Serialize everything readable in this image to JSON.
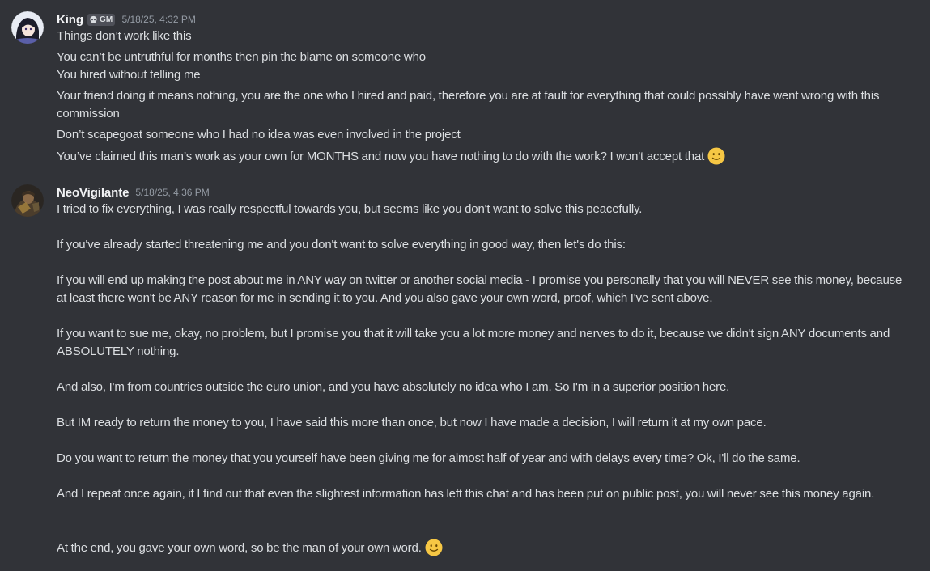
{
  "messages": [
    {
      "username": "King",
      "tag": "GM",
      "tag_icon": "skull-icon",
      "timestamp": "5/18/25, 4:32 PM",
      "lines": [
        "Things don’t work like this",
        "You can’t be untruthful for months then pin the blame on someone who",
        "You hired without telling me",
        "Your friend doing it means nothing, you are the one who I hired and paid, therefore you are at fault for everything that could possibly have went wrong with this commission",
        "Don’t scapegoat someone who I had no idea was even involved in the project",
        "You’ve claimed this man’s work as your own for MONTHS and now you have nothing to do with the work?  I won't accept that"
      ],
      "end_emoji": "slightly-smiling-face-emoji"
    },
    {
      "username": "NeoVigilante",
      "timestamp": "5/18/25, 4:36 PM",
      "lines": [
        "I tried to fix everything, I was really respectful towards you, but seems like you don't want to solve this peacefully.",
        "If you've already started threatening me and you don't want to solve everything in good way, then let's do this:",
        "If you will end up making the post about me in ANY way on twitter or another social media -  I promise you personally that you will NEVER see this money, because at least there won't be ANY reason for me in sending it to you. And you also gave your own word, proof, which I've sent above.",
        "If you want to sue me, okay, no problem, but I promise you that it will take you a lot more money and nerves to do it, because we didn't sign ANY documents and ABSOLUTELY nothing.",
        "And also, I'm from countries outside the euro union, and you have absolutely no idea who I am. So I'm in a superior position here.",
        "But IM ready to return the money to you, I have said this more than once, but now I have made a decision, I will return it at my own pace.",
        "Do you want to return the money that you yourself have been giving me for almost half of year and with delays every time? Ok,  I'll do the same.",
        "And I repeat once again, if I find out that even the slightest information has left this chat and has been put on public post, you will never see this money again.",
        "At the end, you gave your own word, so be the man of your own word."
      ],
      "end_emoji": "slightly-smiling-face-emoji"
    }
  ],
  "colors": {
    "background": "#313338",
    "text": "#dbdee1",
    "username": "#f2f3f5",
    "timestamp": "#949ba4",
    "tag_bg": "#4e5058",
    "emoji": "#f6c744"
  }
}
